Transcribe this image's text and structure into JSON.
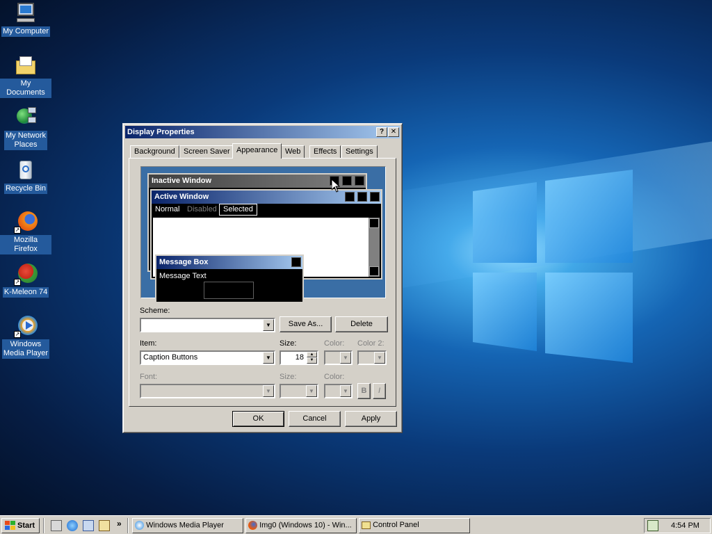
{
  "desktop": {
    "icons": [
      {
        "label": "My Computer"
      },
      {
        "label": "My Documents"
      },
      {
        "label_line1": "My Network",
        "label_line2": "Places"
      },
      {
        "label": "Recycle Bin"
      },
      {
        "label": "Mozilla Firefox"
      },
      {
        "label": "K-Meleon 74"
      },
      {
        "label_line1": "Windows",
        "label_line2": "Media Player"
      }
    ]
  },
  "dialog": {
    "title": "Display Properties",
    "help_button": "?",
    "close_button": "✕",
    "tabs": [
      {
        "label": "Background"
      },
      {
        "label": "Screen Saver"
      },
      {
        "label": "Appearance",
        "active": true
      },
      {
        "label": "Web"
      },
      {
        "label": "Effects"
      },
      {
        "label": "Settings"
      }
    ],
    "preview": {
      "inactive_title": "Inactive Window",
      "active_title": "Active Window",
      "menu_normal": "Normal",
      "menu_disabled": "Disabled",
      "menu_selected": "Selected",
      "msgbox_title": "Message Box",
      "msgbox_text": "Message Text"
    },
    "scheme": {
      "label": "Scheme:",
      "value": "",
      "save_as": "Save As...",
      "delete": "Delete"
    },
    "item": {
      "label": "Item:",
      "value": "Caption Buttons",
      "size_label": "Size:",
      "size_value": "18",
      "color_label": "Color:",
      "color2_label": "Color 2:"
    },
    "font": {
      "label": "Font:",
      "value": "",
      "size_label": "Size:",
      "color_label": "Color:",
      "bold": "B",
      "italic": "I"
    },
    "buttons": {
      "ok": "OK",
      "cancel": "Cancel",
      "apply": "Apply"
    }
  },
  "taskbar": {
    "start": "Start",
    "quicklaunch_more": "»",
    "tasks": [
      {
        "label": "Windows Media Player"
      },
      {
        "label": "Img0 (Windows 10) - Win..."
      },
      {
        "label": "Control Panel"
      }
    ],
    "clock": "4:54 PM"
  }
}
